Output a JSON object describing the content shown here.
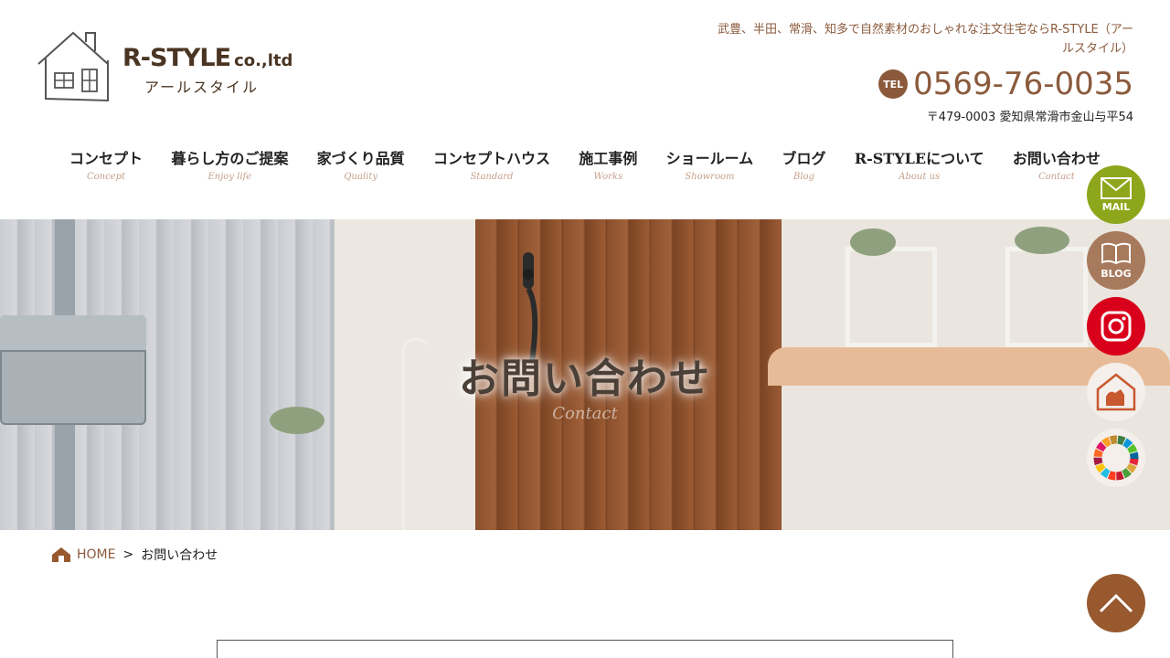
{
  "header": {
    "logo_name": "R-STYLE",
    "logo_suffix": "co.,ltd",
    "logo_sub": "アールスタイル",
    "tagline": "武豊、半田、常滑、知多で自然素材のおしゃれな注文住宅ならR-STYLE（アールスタイル）",
    "tel_badge": "TEL",
    "tel_number": "0569-76-0035",
    "address": "〒479-0003 愛知県常滑市金山与平54"
  },
  "nav": {
    "items": [
      {
        "label": "コンセプト",
        "sub": "Concept"
      },
      {
        "label": "暮らし方のご提案",
        "sub": "Enjoy life"
      },
      {
        "label": "家づくり品質",
        "sub": "Quality"
      },
      {
        "label": "コンセプトハウス",
        "sub": "Standard"
      },
      {
        "label": "施工事例",
        "sub": "Works"
      },
      {
        "label": "ショールーム",
        "sub": "Showroom"
      },
      {
        "label": "ブログ",
        "sub": "Blog"
      },
      {
        "label": "R-STYLEについて",
        "sub": "About us"
      },
      {
        "label": "お問い合わせ",
        "sub": "Contact"
      }
    ]
  },
  "hero": {
    "title": "お問い合わせ",
    "subtitle": "Contact"
  },
  "side_buttons": {
    "mail_label": "MAIL",
    "blog_label": "BLOG"
  },
  "breadcrumb": {
    "home": "HOME",
    "separator": ">",
    "current": "お問い合わせ"
  },
  "colors": {
    "brand_brown": "#8b5a3c",
    "mail_green": "#8ea61b",
    "blog_tan": "#a87a5d",
    "instagram_red": "#d8001a",
    "pagetop_brown": "#98592f"
  },
  "icons": [
    "house-logo-icon",
    "mail-icon",
    "book-icon",
    "instagram-icon",
    "house-dog-icon",
    "sdgs-wheel-icon",
    "home-icon",
    "chevron-up-icon"
  ]
}
